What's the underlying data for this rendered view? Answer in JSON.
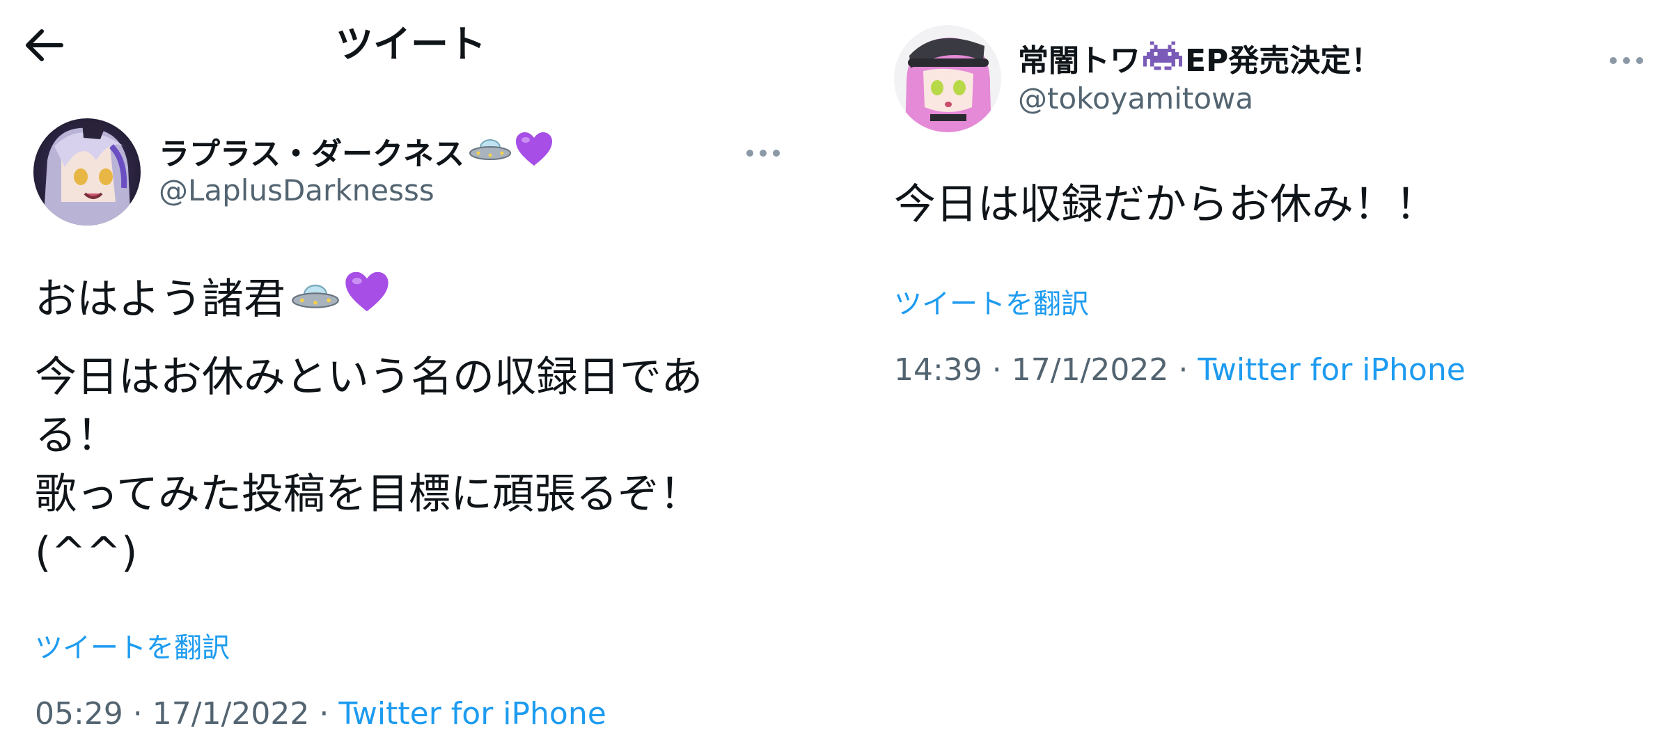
{
  "left_tweet": {
    "header": {
      "title": "ツイート"
    },
    "author": {
      "display_name": "ラプラス・ダークネス",
      "name_emoji": [
        "ufo-emoji",
        "purple-heart-emoji"
      ],
      "handle": "@LaplusDarknesss"
    },
    "text": {
      "line1": "おはよう諸君",
      "line1_emoji": [
        "ufo-emoji",
        "purple-heart-emoji"
      ],
      "line2": "今日はお休みという名の収録日であ",
      "line3": "る！",
      "line4": "歌ってみた投稿を目標に頑張るぞ！",
      "line5": "(^^)"
    },
    "translate_label": "ツイートを翻訳",
    "timestamp": "05:29 · 17/1/2022 · ",
    "source": "Twitter for iPhone"
  },
  "right_tweet": {
    "author": {
      "display_name_part1": "常闇トワ",
      "name_emoji": "space-invader-emoji",
      "display_name_part2": "EP発売決定！",
      "handle": "@tokoyamitowa"
    },
    "text": "今日は収録だからお休み！！",
    "translate_label": "ツイートを翻訳",
    "timestamp": "14:39 · 17/1/2022 · ",
    "source": "Twitter for iPhone"
  },
  "colors": {
    "link_blue": "#1d9bf0",
    "secondary_gray": "#536471",
    "text_dark": "#0f1419"
  }
}
